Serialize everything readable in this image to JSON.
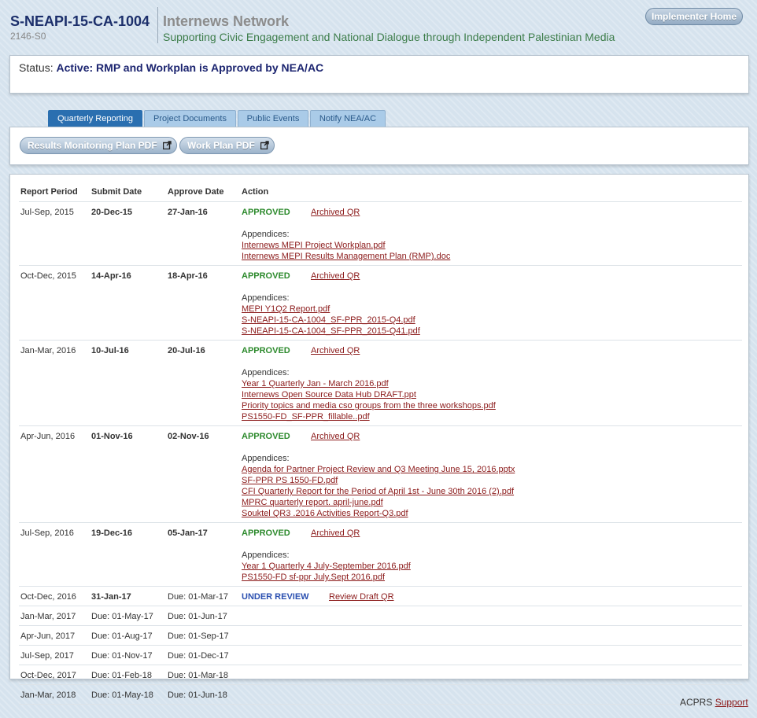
{
  "header": {
    "project_id": "S-NEAPI-15-CA-1004",
    "project_sub": "2146-S0",
    "org_name": "Internews Network",
    "tagline": "Supporting Civic Engagement and National Dialogue through Independent Palestinian Media",
    "home_button": "Implementer Home"
  },
  "status": {
    "label": "Status:",
    "value": "Active: RMP and Workplan is Approved by NEA/AC"
  },
  "tabs": [
    {
      "label": "Quarterly Reporting",
      "active": true
    },
    {
      "label": "Project Documents",
      "active": false
    },
    {
      "label": "Public Events",
      "active": false
    },
    {
      "label": "Notify NEA/AC",
      "active": false
    }
  ],
  "buttons": {
    "rmp_pdf": "Results Monitoring Plan PDF",
    "workplan_pdf": "Work Plan PDF"
  },
  "table": {
    "headers": [
      "Report Period",
      "Submit Date",
      "Approve Date",
      "Action"
    ],
    "appendices_label": "Appendices:",
    "rows": [
      {
        "period": "Jul-Sep, 2015",
        "submit": "20-Dec-15",
        "approve": "27-Jan-16",
        "status": "APPROVED",
        "status_type": "approved",
        "link": "Archived QR",
        "appendices": [
          "Internews MEPI Project Workplan.pdf",
          "Internews MEPI Results Management Plan (RMP).doc"
        ]
      },
      {
        "period": "Oct-Dec, 2015",
        "submit": "14-Apr-16",
        "approve": "18-Apr-16",
        "status": "APPROVED",
        "status_type": "approved",
        "link": "Archived QR",
        "appendices": [
          "MEPI Y1Q2 Report.pdf",
          "S-NEAPI-15-CA-1004_SF-PPR_2015-Q4.pdf",
          "S-NEAPI-15-CA-1004_SF-PPR_2015-Q41.pdf"
        ]
      },
      {
        "period": "Jan-Mar, 2016",
        "submit": "10-Jul-16",
        "approve": "20-Jul-16",
        "status": "APPROVED",
        "status_type": "approved",
        "link": "Archived QR",
        "appendices": [
          "Year 1 Quarterly Jan - March 2016.pdf",
          "Internews Open Source Data Hub DRAFT.ppt",
          "Priority topics and media cso groups from the three workshops.pdf",
          "PS1550-FD_SF-PPR_fillable..pdf"
        ]
      },
      {
        "period": "Apr-Jun, 2016",
        "submit": "01-Nov-16",
        "approve": "02-Nov-16",
        "status": "APPROVED",
        "status_type": "approved",
        "link": "Archived QR",
        "appendices": [
          "Agenda for Partner Project Review and Q3 Meeting June 15, 2016.pptx",
          "SF-PPR PS 1550-FD.pdf",
          "CFI Quarterly Report for the Period of April 1st - June 30th 2016 (2).pdf",
          "MPRC quarterly report. april-june.pdf",
          "Souktel QR3 .2016 Activities Report-Q3.pdf"
        ]
      },
      {
        "period": "Jul-Sep, 2016",
        "submit": "19-Dec-16",
        "approve": "05-Jan-17",
        "status": "APPROVED",
        "status_type": "approved",
        "link": "Archived QR",
        "appendices": [
          "Year 1 Quarterly 4 July-September 2016.pdf",
          "PS1550-FD sf-ppr July.Sept 2016.pdf"
        ]
      },
      {
        "period": "Oct-Dec, 2016",
        "submit": "31-Jan-17",
        "approve": "Due: 01-Mar-17",
        "status": "UNDER REVIEW",
        "status_type": "review",
        "link": "Review Draft QR",
        "appendices": []
      },
      {
        "period": "Jan-Mar, 2017",
        "submit": "Due: 01-May-17",
        "approve": "Due: 01-Jun-17",
        "status": "",
        "status_type": "",
        "link": "",
        "appendices": []
      },
      {
        "period": "Apr-Jun, 2017",
        "submit": "Due: 01-Aug-17",
        "approve": "Due: 01-Sep-17",
        "status": "",
        "status_type": "",
        "link": "",
        "appendices": []
      },
      {
        "period": "Jul-Sep, 2017",
        "submit": "Due: 01-Nov-17",
        "approve": "Due: 01-Dec-17",
        "status": "",
        "status_type": "",
        "link": "",
        "appendices": []
      },
      {
        "period": "Oct-Dec, 2017",
        "submit": "Due: 01-Feb-18",
        "approve": "Due: 01-Mar-18",
        "status": "",
        "status_type": "",
        "link": "",
        "appendices": []
      },
      {
        "period": "Jan-Mar, 2018",
        "submit": "Due: 01-May-18",
        "approve": "Due: 01-Jun-18",
        "status": "",
        "status_type": "",
        "link": "",
        "appendices": []
      }
    ]
  },
  "footer": {
    "app_name": "ACPRS",
    "support_link": "Support"
  },
  "icons": {
    "external_link": "external-link-icon"
  },
  "colors": {
    "approved": "#2d8a2d",
    "under_review": "#2a4fb0",
    "link": "#8b1a1a",
    "active_tab": "#2a6fb0"
  }
}
